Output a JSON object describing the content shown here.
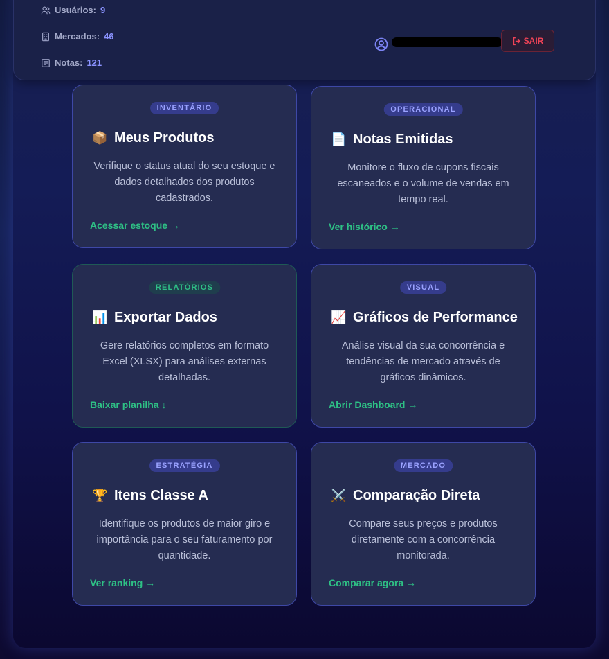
{
  "header": {
    "stats": [
      {
        "label": "Usuários:",
        "value": "9",
        "icon": "users-icon"
      },
      {
        "label": "Mercados:",
        "value": "46",
        "icon": "building-icon"
      },
      {
        "label": "Notas:",
        "value": "121",
        "icon": "receipt-icon"
      }
    ],
    "user_icon": "user-circle-icon",
    "logout_label": "SAIR",
    "logout_icon": "logout-icon"
  },
  "cards": [
    {
      "badge": "INVENTÁRIO",
      "emoji": "📦",
      "title": "Meus Produtos",
      "desc": "Verifique o status atual do seu estoque e dados detalhados dos produtos cadastrados.",
      "link": "Acessar estoque →"
    },
    {
      "badge": "OPERACIONAL",
      "emoji": "📄",
      "title": "Notas Emitidas",
      "desc": "Monitore o fluxo de cupons fiscais escaneados e o volume de vendas em tempo real.",
      "link": "Ver histórico →"
    },
    {
      "badge": "RELATÓRIOS",
      "emoji": "📊",
      "title": "Exportar Dados",
      "desc": "Gere relatórios completos em formato Excel (XLSX) para análises externas detalhadas.",
      "link": "Baixar planilha ↓"
    },
    {
      "badge": "VISUAL",
      "emoji": "📈",
      "title": "Gráficos de Performance",
      "desc": "Análise visual da sua concorrência e tendências de mercado através de gráficos dinâmicos.",
      "link": "Abrir Dashboard →"
    },
    {
      "badge": "ESTRATÉGIA",
      "emoji": "🏆",
      "title": "Itens Classe A",
      "desc": "Identifique os produtos de maior giro e importância para o seu faturamento por quantidade.",
      "link": "Ver ranking →"
    },
    {
      "badge": "MERCADO",
      "emoji": "⚔️",
      "title": "Comparação Direta",
      "desc": "Compare seus preços e produtos diretamente com a concorrência monitorada.",
      "link": "Comparar agora →"
    }
  ],
  "colors": {
    "accent": "#8b93ff",
    "link_green": "#2ec185",
    "danger": "#ef4357",
    "card_bg": "#252c51"
  }
}
